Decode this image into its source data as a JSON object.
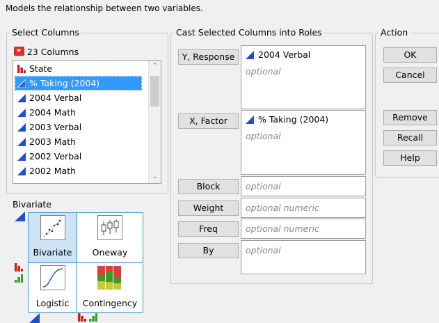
{
  "description": "Models the relationship between two variables.",
  "select_columns": {
    "legend": "Select Columns",
    "count_label": "23 Columns",
    "items": [
      {
        "label": "State",
        "type": "nominal"
      },
      {
        "label": "% Taking (2004)",
        "type": "continuous",
        "selected": true
      },
      {
        "label": "2004 Verbal",
        "type": "continuous"
      },
      {
        "label": "2004 Math",
        "type": "continuous"
      },
      {
        "label": "2003 Verbal",
        "type": "continuous"
      },
      {
        "label": "2003 Math",
        "type": "continuous"
      },
      {
        "label": "2002 Verbal",
        "type": "continuous"
      },
      {
        "label": "2002 Math",
        "type": "continuous"
      }
    ]
  },
  "cast_roles": {
    "legend": "Cast Selected Columns into Roles",
    "roles": [
      {
        "button": "Y, Response",
        "value": "2004 Verbal",
        "hint": "optional"
      },
      {
        "button": "X, Factor",
        "value": "% Taking (2004)",
        "hint": "optional"
      },
      {
        "button": "Block",
        "hint": "optional"
      },
      {
        "button": "Weight",
        "hint": "optional numeric"
      },
      {
        "button": "Freq",
        "hint": "optional numeric"
      },
      {
        "button": "By",
        "hint": "optional"
      }
    ]
  },
  "action": {
    "legend": "Action",
    "ok": "OK",
    "cancel": "Cancel",
    "remove": "Remove",
    "recall": "Recall",
    "help": "Help"
  },
  "palette": {
    "title": "Bivariate",
    "cells": [
      "Bivariate",
      "Oneway",
      "Logistic",
      "Contingency"
    ]
  },
  "colors": {
    "selection": "#3399ff",
    "continuous_icon": "#1f50c8",
    "nominal_icon": "#c8201c",
    "ordinal_icon": "#3f9a2c",
    "palette_border": "#3f8fd2"
  }
}
